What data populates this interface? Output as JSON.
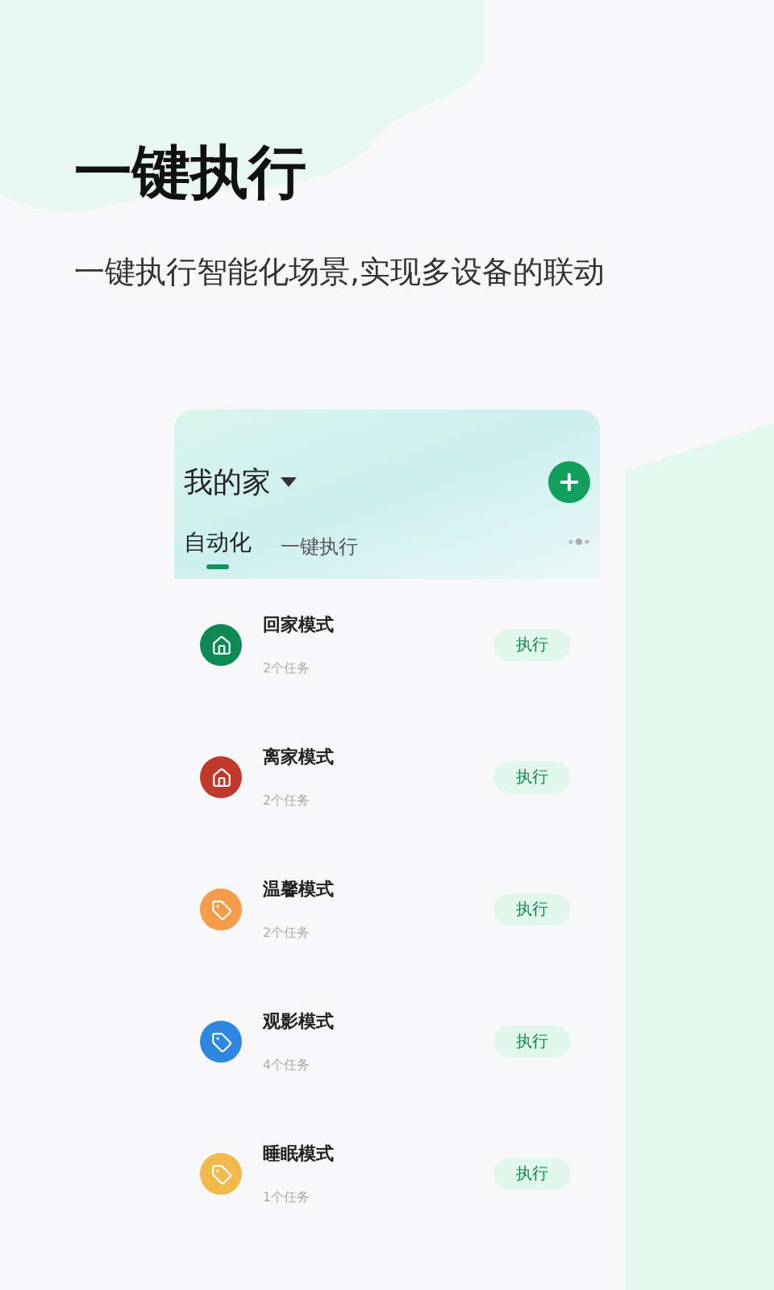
{
  "headline": "一键执行",
  "subtitle": "一键执行智能化场景,实现多设备的联动",
  "card": {
    "home": "我的家",
    "tabs": [
      {
        "label": "自动化",
        "selected": true
      },
      {
        "label": "一键执行",
        "selected": false
      }
    ],
    "scenes": [
      {
        "name": "回家模式",
        "tasks": "2个任务",
        "kind": "home",
        "color": "#0f8a55",
        "action": "执行"
      },
      {
        "name": "离家模式",
        "tasks": "2个任务",
        "kind": "home",
        "color": "#c0392b",
        "action": "执行"
      },
      {
        "name": "温馨模式",
        "tasks": "2个任务",
        "kind": "tag",
        "color": "#f39c4a",
        "action": "执行"
      },
      {
        "name": "观影模式",
        "tasks": "4个任务",
        "kind": "tag",
        "color": "#2e86de",
        "action": "执行"
      },
      {
        "name": "睡眠模式",
        "tasks": "1个任务",
        "kind": "tag",
        "color": "#f0b94a",
        "action": "执行"
      }
    ]
  }
}
